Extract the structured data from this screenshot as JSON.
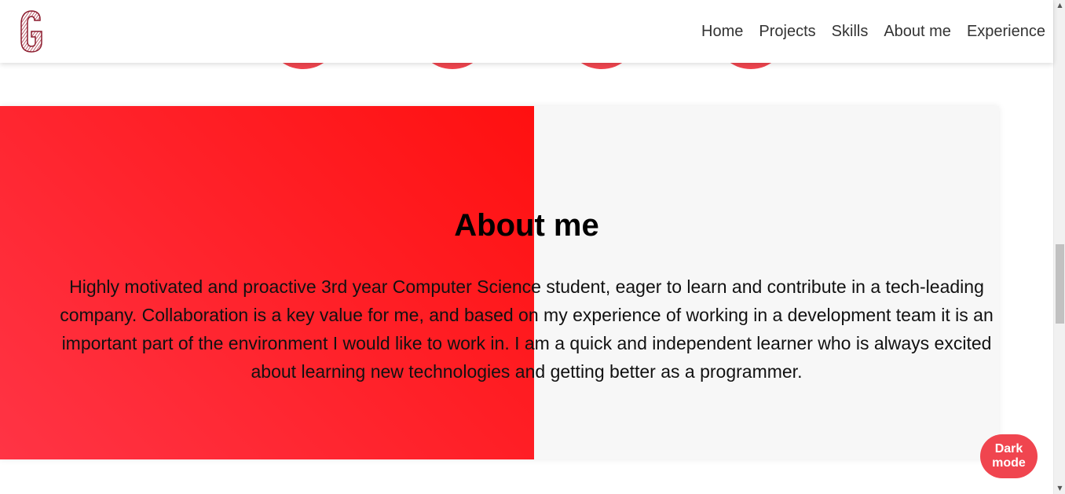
{
  "header": {
    "logo_letter": "G",
    "nav": {
      "home": "Home",
      "projects": "Projects",
      "skills": "Skills",
      "about": "About me",
      "experience": "Experience"
    }
  },
  "about": {
    "title": "About me",
    "text": "Highly motivated and proactive 3rd year Computer Science student, eager to learn and contribute in a tech-leading company. Collaboration is a key value for me, and based on my experience of working in a development team it is an important part of the environment I would like to work in. I am a quick and independent learner who is always excited about learning new technologies and getting better as a programmer."
  },
  "dark_mode_button": {
    "label": "Dark mode"
  },
  "colors": {
    "accent": "#f0454f",
    "red_gradient_start": "#ff3445",
    "red_gradient_end": "#ff1010",
    "section_bg": "#f7f7f7"
  }
}
